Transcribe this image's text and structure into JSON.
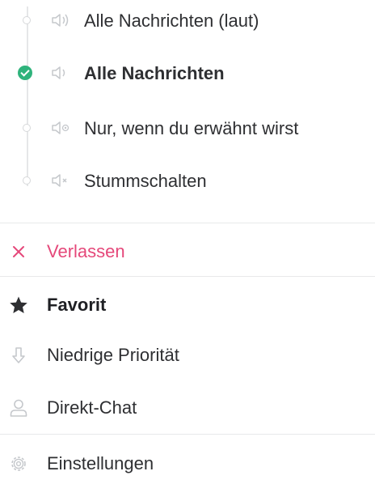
{
  "notifications": {
    "selected_index": 1,
    "options": [
      {
        "label": "Alle Nachrichten (laut)",
        "icon": "speaker-loud-icon"
      },
      {
        "label": "Alle Nachrichten",
        "icon": "speaker-icon"
      },
      {
        "label": "Nur, wenn du erwähnt wirst",
        "icon": "speaker-mention-icon"
      },
      {
        "label": "Stummschalten",
        "icon": "speaker-muted-icon"
      }
    ]
  },
  "actions": {
    "leave": {
      "label": "Verlassen",
      "icon": "close-icon",
      "color": "#e5487a"
    },
    "favourite": {
      "label": "Favorit",
      "icon": "star-icon"
    },
    "low_priority": {
      "label": "Niedrige Priorität",
      "icon": "low-priority-icon"
    },
    "direct_chat": {
      "label": "Direkt-Chat",
      "icon": "person-icon"
    },
    "settings": {
      "label": "Einstellungen",
      "icon": "gear-icon"
    }
  },
  "colors": {
    "selected_radio": "#2fb37c",
    "text": "#2e2f32",
    "icon": "#c5c8cc",
    "divider": "#e8e9ea"
  }
}
